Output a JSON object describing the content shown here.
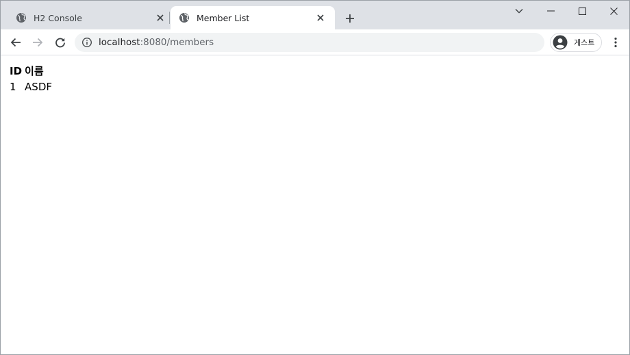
{
  "tabs": [
    {
      "title": "H2 Console",
      "active": false,
      "icon": "globe-icon"
    },
    {
      "title": "Member List",
      "active": true,
      "icon": "globe-icon"
    }
  ],
  "toolbar": {
    "url_host": "localhost",
    "url_rest": ":8080/members",
    "profile_label": "게스트"
  },
  "page": {
    "headers": [
      "ID",
      "이름"
    ],
    "rows": [
      [
        "1",
        "ASDF"
      ]
    ]
  },
  "colors": {
    "tabstrip": "#dee1e6",
    "omnibox": "#f1f3f4",
    "icon": "#5f6368"
  }
}
